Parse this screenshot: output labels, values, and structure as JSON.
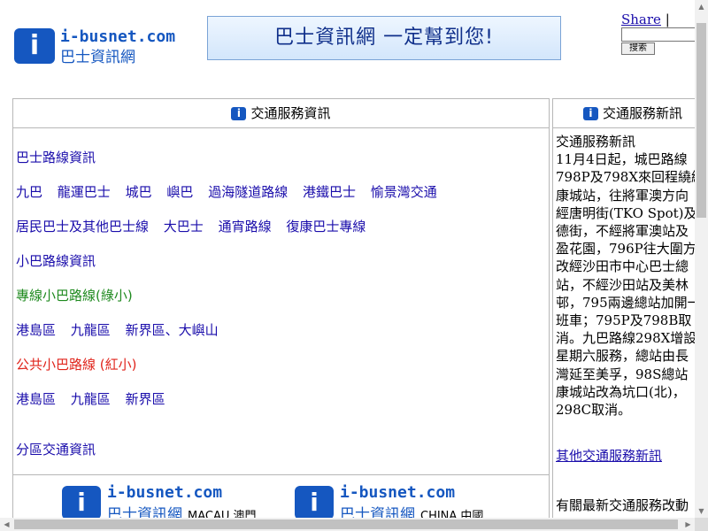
{
  "header": {
    "logo_mark": "i",
    "logo_domain": "i-busnet.com",
    "logo_name": "巴士資訊網",
    "banner": "巴士資訊網 一定幫到您!",
    "share_label": "Share",
    "share_sep": "|",
    "search_button": "搜索"
  },
  "main": {
    "title": "交通服務資訊",
    "bus_heading": "巴士路線資訊",
    "bus_row1": [
      "九巴",
      "龍運巴士",
      "城巴",
      "嶼巴",
      "過海隧道路線",
      "港鐵巴士",
      "愉景灣交通"
    ],
    "bus_row2": [
      "居民巴士及其他巴士線",
      "大巴士",
      "通宵路線",
      "復康巴士專線"
    ],
    "minibus_heading": "小巴路線資訊",
    "green_heading": "專線小巴路線(綠小)",
    "green_row": [
      "港島區",
      "九龍區",
      "新界區、大嶼山"
    ],
    "red_heading": "公共小巴路線 (紅小)",
    "red_row": [
      "港島區",
      "九龍區",
      "新界區"
    ],
    "district_heading": "分區交通資訊",
    "macau_logo": {
      "mark": "i",
      "domain": "i-busnet.com",
      "name": "巴士資訊網",
      "region": "MACAU 澳門"
    },
    "china_logo": {
      "mark": "i",
      "domain": "i-busnet.com",
      "name": "巴士資訊網",
      "region": "CHINA 中國"
    }
  },
  "side": {
    "title": "交通服務新訊",
    "lines": [
      "交通服務新訊",
      "11月4日起，城巴路線",
      "798P及798X來回程繞經",
      "康城站，往將軍澳方向",
      "經唐明街(TKO Spot)及",
      "德街，不經將軍澳站及",
      "盈花園，796P往大圍方",
      "改經沙田市中心巴士總",
      "站，不經沙田站及美林",
      "邨，795兩邊總站加開一",
      "班車；795P及798B取",
      "消。九巴路線298X增設",
      "星期六服務，總站由長",
      "灣延至美孚，98S總站",
      "康城站改為坑口(北)，",
      "298C取消。"
    ],
    "more_link": "其他交通服務新訊",
    "bottom_text": "有關最新交通服務改動"
  }
}
